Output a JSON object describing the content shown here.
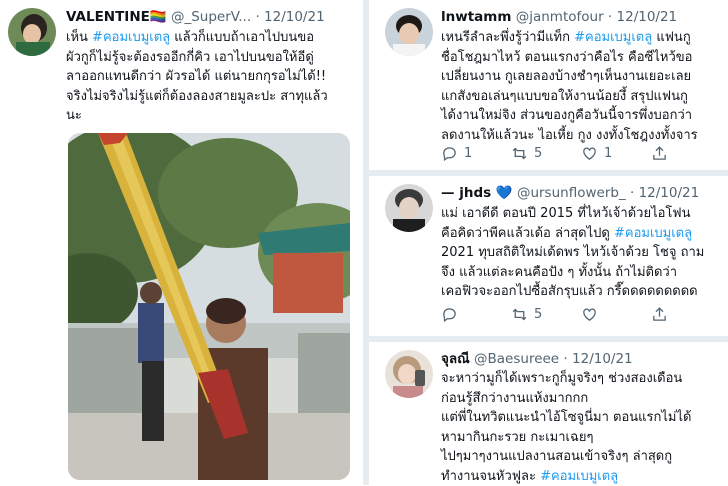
{
  "tweets": [
    {
      "name": "VALENTINE🏳️‍🌈",
      "handle": "@_SuperV...",
      "date": "12/10/21",
      "lines": [
        {
          "pre": "เห็น ",
          "tag": "#คอมเบมูเตลู",
          "post": " แล้วก็แบบถ้าเอาไปบนขอ"
        },
        {
          "pre": "ผัวกูก็ไม่รู้จะต้องรออีกกี่คิว เอาไปบนขอให้อีดู่"
        },
        {
          "pre": "ลาออกแทนดีกว่า ผัวรอได้ แต่นายกกุรอไม่ได้!!"
        },
        {
          "pre": "จริงไม่จริงไม่รู้แต่ก็ต้องลองสายมูละปะ สาทุแล้ว"
        },
        {
          "pre": "นะ"
        }
      ]
    },
    {
      "name": "lnwtamm",
      "handle": "@janmtofour",
      "date": "12/10/21",
      "lines": [
        {
          "pre": "เหนรีลำละพึ่งรู้ว่ามีแท็ก ",
          "tag": "#คอมเบมูเตลู",
          "post": " แฟนกู"
        },
        {
          "pre": "ชื่อโชฎมาไหว้ ตอนแรกงว่าคือไร คือซีไหว้ขอ"
        },
        {
          "pre": "เปลี่ยนงาน กูเลยลองบ้างชำๆเห็นงานเยอะเลย"
        },
        {
          "pre": "แกสังขอเล่นๆแบบขอให้งานน้อยงึ้ สรุปแฟนกู"
        },
        {
          "pre": "ได้งานใหม่จิง ส่วนของกูคือวันนี้จารพึ่งบอกว่า"
        },
        {
          "pre": "ลดงานให้แล้วนะ ไอเหี้ย กูง งงทั้งโชฎงงทั้งจาร"
        }
      ],
      "replies": "1",
      "retweets": "5",
      "likes": "1"
    },
    {
      "name": "— jhds 💙",
      "handle": "@ursunflowerb_",
      "date": "12/10/21",
      "lines": [
        {
          "pre": "แม่ เอาดีดี ตอนปี 2015 ที่ไหว้เจ้าด้วยไอโฟน"
        },
        {
          "pre": "คือคิดว่าพีคแล้วเด้อ ล่าสุดไปดู ",
          "tag": "#คอมเบมูเตลู"
        },
        {
          "pre": "2021 ทุบสถิติใหม่เด้ดพร ไหว้เจ้าด้วย โชจู ถาม"
        },
        {
          "pre": "จึง แล้วแต่ละคนคือปัง ๆ ทั้งนั้น ถ้าไม่ติดว่า"
        },
        {
          "pre": "เคอฟิวจะออกไปซื้อสักรุบแล้ว กรี๊ดดดดดดดดด"
        }
      ],
      "replies": "",
      "retweets": "5",
      "likes": ""
    },
    {
      "name": "จุลณี",
      "handle": "@Baesureee",
      "date": "12/10/21",
      "lines": [
        {
          "pre": "จะหาว่ามูก็ได้เพราะกูก็มูจริงๆ ช่วงสองเดือน"
        },
        {
          "pre": "ก่อนรู้สึกว่างานแห้งมากกก"
        },
        {
          "pre": "แต่พี่ในทวิตแนะนำไอ้โซจูนี่มา ตอนแรกไม่ได้"
        },
        {
          "pre": "หามากินกะรวย กะเมาเฉยๆ"
        },
        {
          "pre": "ไปๆมาๆงานแปลงานสอนเข้าจริงๆ ล่าสุดกู"
        },
        {
          "pre": "ทำงานจนหัวฟูละ ",
          "tag": "#คอมเบมูเตลู"
        }
      ]
    }
  ]
}
